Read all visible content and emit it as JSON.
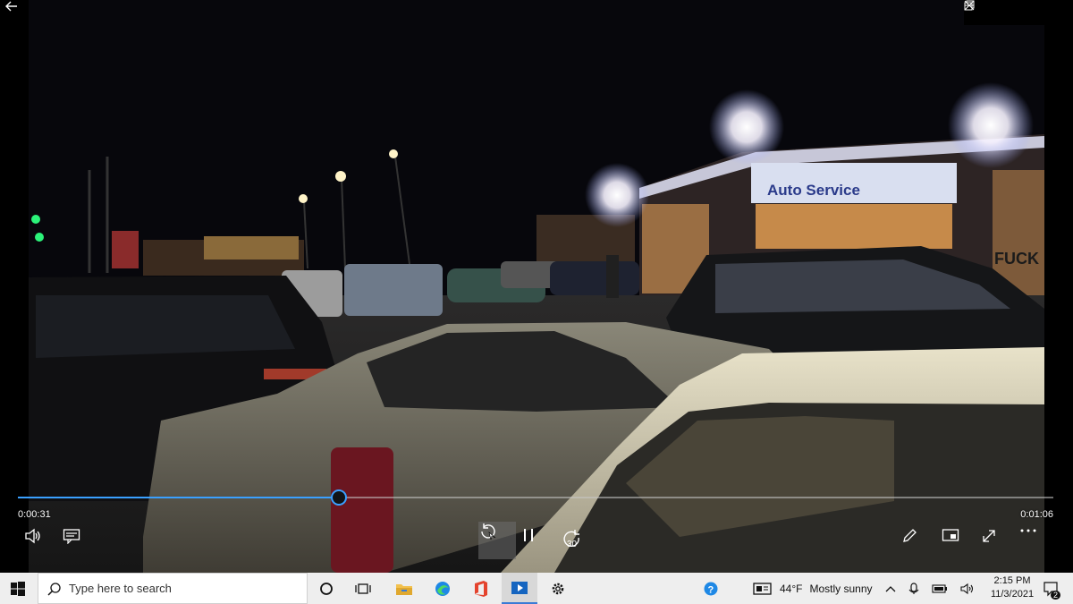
{
  "player": {
    "time_current": "0:00:31",
    "time_total": "0:01:06",
    "progress": 0.31,
    "skip_forward_label": "30",
    "accent_color": "#3aa0ff"
  },
  "video_scene": {
    "sign_text": "Auto Service",
    "graffiti_text": "FUCK"
  },
  "window_controls": [
    "minimize-icon",
    "restore-icon",
    "close-icon"
  ],
  "taskbar": {
    "search_placeholder": "Type here to search",
    "weather_temp": "44°F",
    "weather_desc": "Mostly sunny",
    "clock_time": "2:15 PM",
    "clock_date": "11/3/2021",
    "notification_count": "2",
    "pinned_apps": [
      "cortana-icon",
      "task-view-icon",
      "file-explorer-icon",
      "edge-icon",
      "office-icon",
      "movies-tv-icon",
      "settings-icon"
    ]
  }
}
